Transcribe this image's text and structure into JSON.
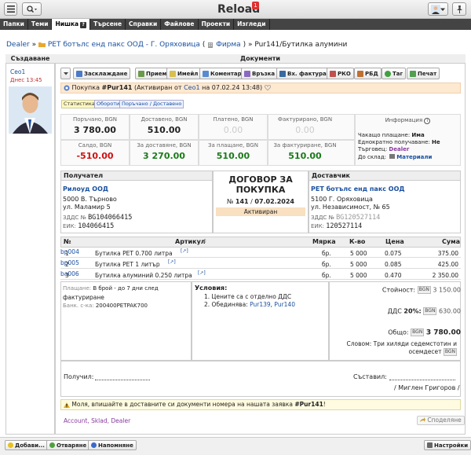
{
  "app": {
    "title": "Reload",
    "notification_count": "1"
  },
  "menu": {
    "items": [
      "Папки",
      "Теми",
      "Нишка",
      "Търсене",
      "Справки",
      "Файлове",
      "Проекти",
      "Изгледи"
    ],
    "help_glyph": "?"
  },
  "breadcrumb": {
    "root": "Dealer",
    "sep1": "»",
    "company": "PET ботълс енд пакс ООД - Г. Оряховица",
    "firm_open": "(",
    "firm": "Фирма",
    "firm_close": ")",
    "sep2": "»",
    "current": "Pur141/Бутилка алумини"
  },
  "left": {
    "header": "Създаване",
    "user": "Ceo1",
    "date": "Днес 13:45"
  },
  "docs": {
    "header": "Документи",
    "toolbar": [
      "Засклаждане",
      "Приемане",
      "Имейл",
      "Коментар",
      "Връзка",
      "Вх. фактура",
      "РКО",
      "РБД",
      "Таг",
      "Печат"
    ],
    "title_prefix": "Покупка",
    "doc_id": "#Pur141",
    "activated_text": "(Активиран от",
    "activated_by": "Ceo1",
    "activated_on": "на 07.02.24 13:48)",
    "tabs": [
      "Статистика",
      "Обороти",
      "Поръчано / Доставено"
    ]
  },
  "stats": {
    "ordered_label": "Поръчано, BGN",
    "ordered": "3 780.00",
    "delivered_label": "Доставено, BGN",
    "delivered": "510.00",
    "paid_label": "Платено, BGN",
    "paid": "0.00",
    "invoiced_label": "Фактурирано, BGN",
    "invoiced": "0.00",
    "balance_label": "Салдо, BGN",
    "balance": "-510.00",
    "to_deliver_label": "За доставяне, BGN",
    "to_deliver": "3 270.00",
    "to_pay_label": "За плащане, BGN",
    "to_pay": "510.00",
    "to_invoice_label": "За фактуриране, BGN",
    "to_invoice": "510.00",
    "info_label": "Информация",
    "info_glyph": "i",
    "pending_label": "Чакащо плащане:",
    "pending": "Има",
    "onetime_label": "Еднократно получаване:",
    "onetime": "Не",
    "dealer_label": "Търговец:",
    "dealer": "Dealer",
    "store_label": "До склад:",
    "store": "Материали"
  },
  "recipient": {
    "header": "Получател",
    "name": "Рилоуд ООД",
    "city": "5000 В. Търново",
    "street": "ул. Маламир 5",
    "vat_label": "ЗДДС №",
    "vat": "BG104066415",
    "eik_label": "ЕИК:",
    "eik": "104066415"
  },
  "contract": {
    "title": "ДОГОВОР ЗА ПОКУПКА",
    "number_prefix": "№",
    "number": "141",
    "sep": "/",
    "date": "07.02.2024",
    "state": "Активиран"
  },
  "supplier": {
    "header": "Доставчик",
    "name": "PET ботълс енд пакс ООД",
    "city": "5100 Г. Оряховица",
    "street": "ул. Независимост, № 65",
    "vat_label": "ЗДДС №",
    "vat": "BG120527114",
    "eik_label": "ЕИК:",
    "eik": "120527114"
  },
  "table": {
    "headers": {
      "no": "№",
      "article": "Артикул",
      "unit": "Мярка",
      "qty": "К-во",
      "price": "Цена",
      "sum": "Сума"
    },
    "rows": [
      {
        "no": "1",
        "code": "bp004",
        "name": "Бутилка PET 0.700 литра",
        "unit": "бр.",
        "qty": "5 000",
        "price": "0.075",
        "sum": "375.00"
      },
      {
        "no": "2",
        "code": "bp005",
        "name": "Бутилка PET 1 литър",
        "unit": "бр.",
        "qty": "5 000",
        "price": "0.085",
        "sum": "425.00"
      },
      {
        "no": "3",
        "code": "ba006",
        "name": "Бутилка алуминий 0.250 литра",
        "unit": "бр.",
        "qty": "5 000",
        "price": "0.470",
        "sum": "2 350.00"
      }
    ]
  },
  "payment": {
    "label": "Плащане:",
    "text1": "В брой - до 7 дни след",
    "text2": "фактуриране",
    "bank_label": "Банк. с-ка:",
    "bank": "200400PETPAK700"
  },
  "conditions": {
    "title": "Условия:",
    "c1": "1. Цените са с отделно ДДС",
    "c2_prefix": "2. Обединява:",
    "c2_a": "Pur139",
    "c2_sep": ",",
    "c2_b": "Pur140"
  },
  "totals": {
    "value_label": "Стойност:",
    "currency": "BGN",
    "value": "3 150.00",
    "vat_label": "ДДС",
    "vat_rate": "20%:",
    "vat": "630.00",
    "total_label": "Общо:",
    "total": "3 780.00",
    "words": "Словом: Три хиляди седемстотин и осемдесет"
  },
  "sign": {
    "receiver_label": "Получил:",
    "author_label": "Съставил:",
    "author_name": "/ Миглен Григоров /"
  },
  "note": {
    "text": "Моля, впишайте в доставните си документи номера на нашата заявка",
    "order": "#Pur141",
    "end": "!"
  },
  "footer": {
    "links": [
      "Account",
      "Sklad",
      "Dealer"
    ],
    "sep": ",",
    "share": "Споделяне"
  },
  "bottom": {
    "add": "Добави...",
    "open": "Отваряне",
    "remind": "Напомняне",
    "settings": "Настройки"
  }
}
